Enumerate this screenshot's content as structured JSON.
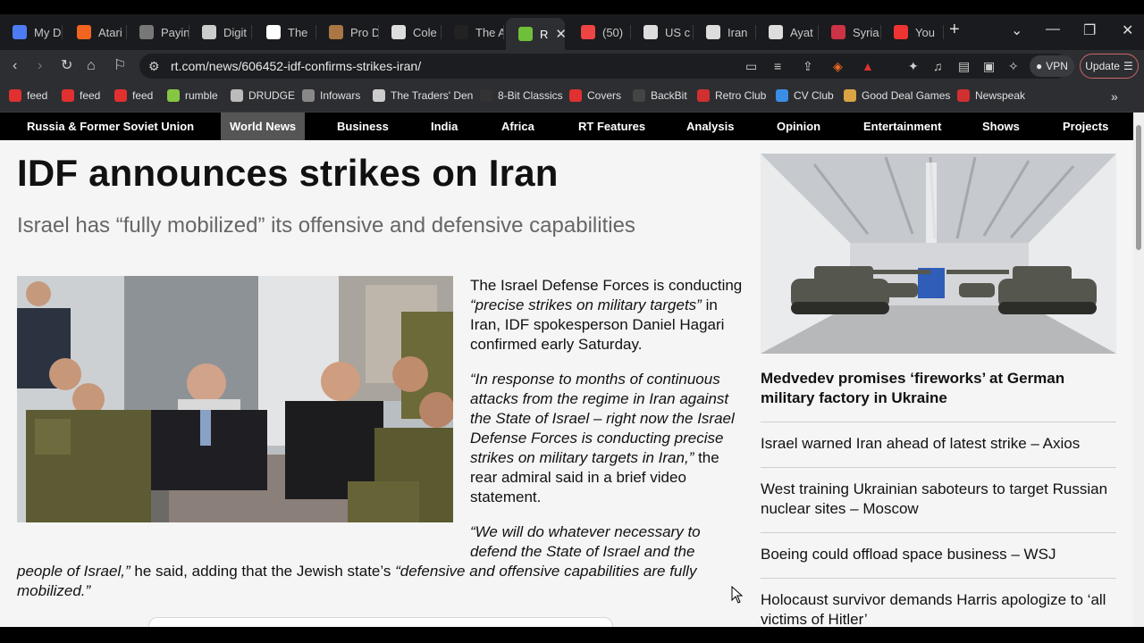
{
  "tabs": [
    {
      "label": "My D",
      "icon": "shield-icon",
      "color": "#4d7cf2"
    },
    {
      "label": "Atari",
      "icon": "etsy-icon",
      "color": "#f16521"
    },
    {
      "label": "Payin",
      "icon": "face-icon",
      "color": "#777777"
    },
    {
      "label": "Digit",
      "icon": "car-icon",
      "color": "#cccccc"
    },
    {
      "label": "The ",
      "icon": "b-icon",
      "color": "#ffffff"
    },
    {
      "label": "Pro D",
      "icon": "bag-icon",
      "color": "#aa7744"
    },
    {
      "label": "Cole",
      "icon": "building-icon",
      "color": "#dddddd"
    },
    {
      "label": "The A",
      "icon": "dark-logo-icon",
      "color": "#222222"
    },
    {
      "label": "R",
      "icon": "rt-icon",
      "color": "#6fbf3a"
    },
    {
      "label": "(50)",
      "icon": "fire-icon",
      "color": "#e44"
    },
    {
      "label": "US c",
      "icon": "person-icon",
      "color": "#dddddd"
    },
    {
      "label": "Iran ",
      "icon": "person-icon",
      "color": "#dddddd"
    },
    {
      "label": "Ayat",
      "icon": "person-icon",
      "color": "#dddddd"
    },
    {
      "label": "Syria",
      "icon": "globe-icon",
      "color": "#cc3344"
    },
    {
      "label": "You ",
      "icon": "circle-icon",
      "color": "#e33"
    }
  ],
  "browser": {
    "url": "rt.com/news/606452-idf-confirms-strikes-iran/",
    "vpn_label": "VPN",
    "update_label": "Update"
  },
  "bookmarks": [
    {
      "label": "feed",
      "color": "#e03030"
    },
    {
      "label": "feed",
      "color": "#e03030"
    },
    {
      "label": "feed",
      "color": "#e03030"
    },
    {
      "label": "rumble",
      "color": "#85c742"
    },
    {
      "label": "DRUDGE",
      "color": "#bbbbbb"
    },
    {
      "label": "Infowars",
      "color": "#888888"
    },
    {
      "label": "The Traders' Den",
      "color": "#cccccc"
    },
    {
      "label": "8-Bit Classics",
      "color": "#333333"
    },
    {
      "label": "Covers",
      "color": "#e03030"
    },
    {
      "label": "BackBit",
      "color": "#444444"
    },
    {
      "label": "Retro Club",
      "color": "#d03030"
    },
    {
      "label": "CV Club",
      "color": "#3a8ee6"
    },
    {
      "label": "Good Deal Games",
      "color": "#d9a441"
    },
    {
      "label": "Newspeak",
      "color": "#d03030"
    }
  ],
  "nav": [
    "Russia & Former Soviet Union",
    "World News",
    "Business",
    "India",
    "Africa",
    "RT Features",
    "Analysis",
    "Opinion",
    "Entertainment",
    "Shows",
    "Projects"
  ],
  "nav_active": "World News",
  "article": {
    "headline": "IDF announces strikes on Iran",
    "subheadline": "Israel has “fully mobilized” its offensive and defensive capabilities",
    "p1_a": "The Israel Defense Forces is conducting ",
    "p1_b": "“precise strikes on military targets”",
    "p1_c": " in Iran, IDF spokesperson Daniel Hagari confirmed early Saturday.",
    "p2_quote": "“In response to months of continuous attacks from the regime in Iran against the State of Israel – right now the Israel Defense Forces is conducting precise strikes on military targets in Iran,”",
    "p2_tail": " the rear admiral said in a brief video statement.",
    "p3_quote_1": "“We will do whatever necessary to defend the State of Israel and the people of Israel,”",
    "p3_mid": " he said, adding that the Jewish state’s ",
    "p3_quote_2": "“defensive and offensive capabilities are fully mobilized.”"
  },
  "sidebar": {
    "lead": "Medvedev promises ‘fireworks’ at German military factory in Ukraine",
    "links": [
      "Israel warned Iran ahead of latest strike – Axios",
      "West training Ukrainian saboteurs to target Russian nuclear sites – Moscow",
      "Boeing could offload space business – WSJ",
      "Holocaust survivor demands Harris apologize to ‘all victims of Hitler’"
    ]
  }
}
